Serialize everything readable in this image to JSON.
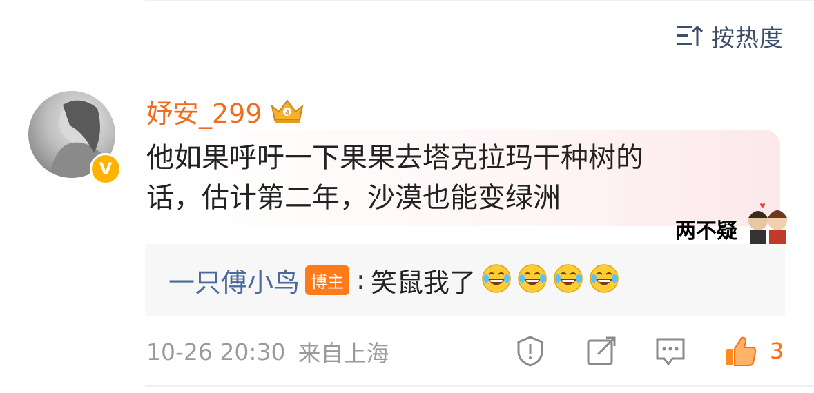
{
  "sort": {
    "label": "按热度",
    "icon": "sort-icon"
  },
  "comment": {
    "username": "妤安_299",
    "user_badge_icon": "crown-badge-icon",
    "verified_icon": "verified-v-icon",
    "text": "他如果呼吁一下果果去塔克拉玛干种树的\n话，估计第二年，沙漠也能变绿洲",
    "sticker_text": "两不疑"
  },
  "reply": {
    "user": "一只傅小鸟",
    "author_badge": "博主",
    "separator": ":",
    "text": "笑鼠我了",
    "emoji_icon": "laugh-cry-emoji-icon",
    "emoji_count": 4
  },
  "footer": {
    "time": "10-26 20:30",
    "location": "来自上海",
    "like_count": "3",
    "icons": [
      "report-icon",
      "share-icon",
      "reply-icon",
      "like-icon"
    ]
  },
  "colors": {
    "username": "#f26b1d",
    "reply_user": "#4b6a9b",
    "like": "#ff6d14",
    "meta": "#9a9a9a"
  }
}
